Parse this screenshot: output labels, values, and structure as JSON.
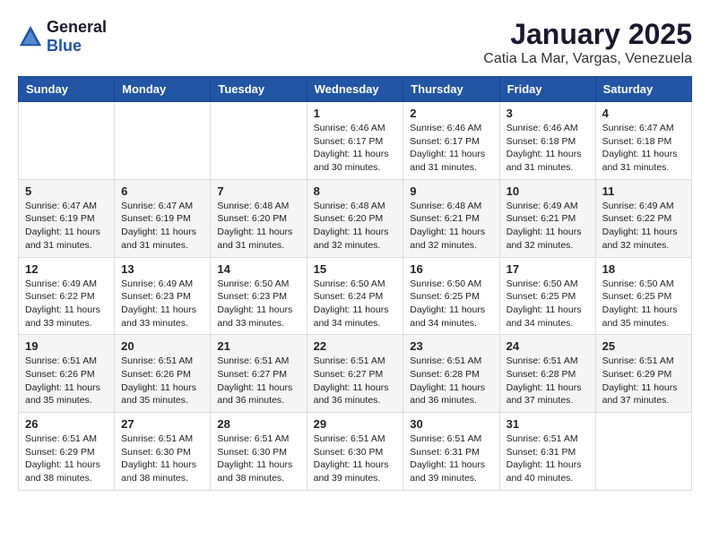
{
  "header": {
    "logo_general": "General",
    "logo_blue": "Blue",
    "month": "January 2025",
    "location": "Catia La Mar, Vargas, Venezuela"
  },
  "weekdays": [
    "Sunday",
    "Monday",
    "Tuesday",
    "Wednesday",
    "Thursday",
    "Friday",
    "Saturday"
  ],
  "weeks": [
    [
      {
        "day": "",
        "info": ""
      },
      {
        "day": "",
        "info": ""
      },
      {
        "day": "",
        "info": ""
      },
      {
        "day": "1",
        "info": "Sunrise: 6:46 AM\nSunset: 6:17 PM\nDaylight: 11 hours\nand 30 minutes."
      },
      {
        "day": "2",
        "info": "Sunrise: 6:46 AM\nSunset: 6:17 PM\nDaylight: 11 hours\nand 31 minutes."
      },
      {
        "day": "3",
        "info": "Sunrise: 6:46 AM\nSunset: 6:18 PM\nDaylight: 11 hours\nand 31 minutes."
      },
      {
        "day": "4",
        "info": "Sunrise: 6:47 AM\nSunset: 6:18 PM\nDaylight: 11 hours\nand 31 minutes."
      }
    ],
    [
      {
        "day": "5",
        "info": "Sunrise: 6:47 AM\nSunset: 6:19 PM\nDaylight: 11 hours\nand 31 minutes."
      },
      {
        "day": "6",
        "info": "Sunrise: 6:47 AM\nSunset: 6:19 PM\nDaylight: 11 hours\nand 31 minutes."
      },
      {
        "day": "7",
        "info": "Sunrise: 6:48 AM\nSunset: 6:20 PM\nDaylight: 11 hours\nand 31 minutes."
      },
      {
        "day": "8",
        "info": "Sunrise: 6:48 AM\nSunset: 6:20 PM\nDaylight: 11 hours\nand 32 minutes."
      },
      {
        "day": "9",
        "info": "Sunrise: 6:48 AM\nSunset: 6:21 PM\nDaylight: 11 hours\nand 32 minutes."
      },
      {
        "day": "10",
        "info": "Sunrise: 6:49 AM\nSunset: 6:21 PM\nDaylight: 11 hours\nand 32 minutes."
      },
      {
        "day": "11",
        "info": "Sunrise: 6:49 AM\nSunset: 6:22 PM\nDaylight: 11 hours\nand 32 minutes."
      }
    ],
    [
      {
        "day": "12",
        "info": "Sunrise: 6:49 AM\nSunset: 6:22 PM\nDaylight: 11 hours\nand 33 minutes."
      },
      {
        "day": "13",
        "info": "Sunrise: 6:49 AM\nSunset: 6:23 PM\nDaylight: 11 hours\nand 33 minutes."
      },
      {
        "day": "14",
        "info": "Sunrise: 6:50 AM\nSunset: 6:23 PM\nDaylight: 11 hours\nand 33 minutes."
      },
      {
        "day": "15",
        "info": "Sunrise: 6:50 AM\nSunset: 6:24 PM\nDaylight: 11 hours\nand 34 minutes."
      },
      {
        "day": "16",
        "info": "Sunrise: 6:50 AM\nSunset: 6:25 PM\nDaylight: 11 hours\nand 34 minutes."
      },
      {
        "day": "17",
        "info": "Sunrise: 6:50 AM\nSunset: 6:25 PM\nDaylight: 11 hours\nand 34 minutes."
      },
      {
        "day": "18",
        "info": "Sunrise: 6:50 AM\nSunset: 6:25 PM\nDaylight: 11 hours\nand 35 minutes."
      }
    ],
    [
      {
        "day": "19",
        "info": "Sunrise: 6:51 AM\nSunset: 6:26 PM\nDaylight: 11 hours\nand 35 minutes."
      },
      {
        "day": "20",
        "info": "Sunrise: 6:51 AM\nSunset: 6:26 PM\nDaylight: 11 hours\nand 35 minutes."
      },
      {
        "day": "21",
        "info": "Sunrise: 6:51 AM\nSunset: 6:27 PM\nDaylight: 11 hours\nand 36 minutes."
      },
      {
        "day": "22",
        "info": "Sunrise: 6:51 AM\nSunset: 6:27 PM\nDaylight: 11 hours\nand 36 minutes."
      },
      {
        "day": "23",
        "info": "Sunrise: 6:51 AM\nSunset: 6:28 PM\nDaylight: 11 hours\nand 36 minutes."
      },
      {
        "day": "24",
        "info": "Sunrise: 6:51 AM\nSunset: 6:28 PM\nDaylight: 11 hours\nand 37 minutes."
      },
      {
        "day": "25",
        "info": "Sunrise: 6:51 AM\nSunset: 6:29 PM\nDaylight: 11 hours\nand 37 minutes."
      }
    ],
    [
      {
        "day": "26",
        "info": "Sunrise: 6:51 AM\nSunset: 6:29 PM\nDaylight: 11 hours\nand 38 minutes."
      },
      {
        "day": "27",
        "info": "Sunrise: 6:51 AM\nSunset: 6:30 PM\nDaylight: 11 hours\nand 38 minutes."
      },
      {
        "day": "28",
        "info": "Sunrise: 6:51 AM\nSunset: 6:30 PM\nDaylight: 11 hours\nand 38 minutes."
      },
      {
        "day": "29",
        "info": "Sunrise: 6:51 AM\nSunset: 6:30 PM\nDaylight: 11 hours\nand 39 minutes."
      },
      {
        "day": "30",
        "info": "Sunrise: 6:51 AM\nSunset: 6:31 PM\nDaylight: 11 hours\nand 39 minutes."
      },
      {
        "day": "31",
        "info": "Sunrise: 6:51 AM\nSunset: 6:31 PM\nDaylight: 11 hours\nand 40 minutes."
      },
      {
        "day": "",
        "info": ""
      }
    ]
  ]
}
